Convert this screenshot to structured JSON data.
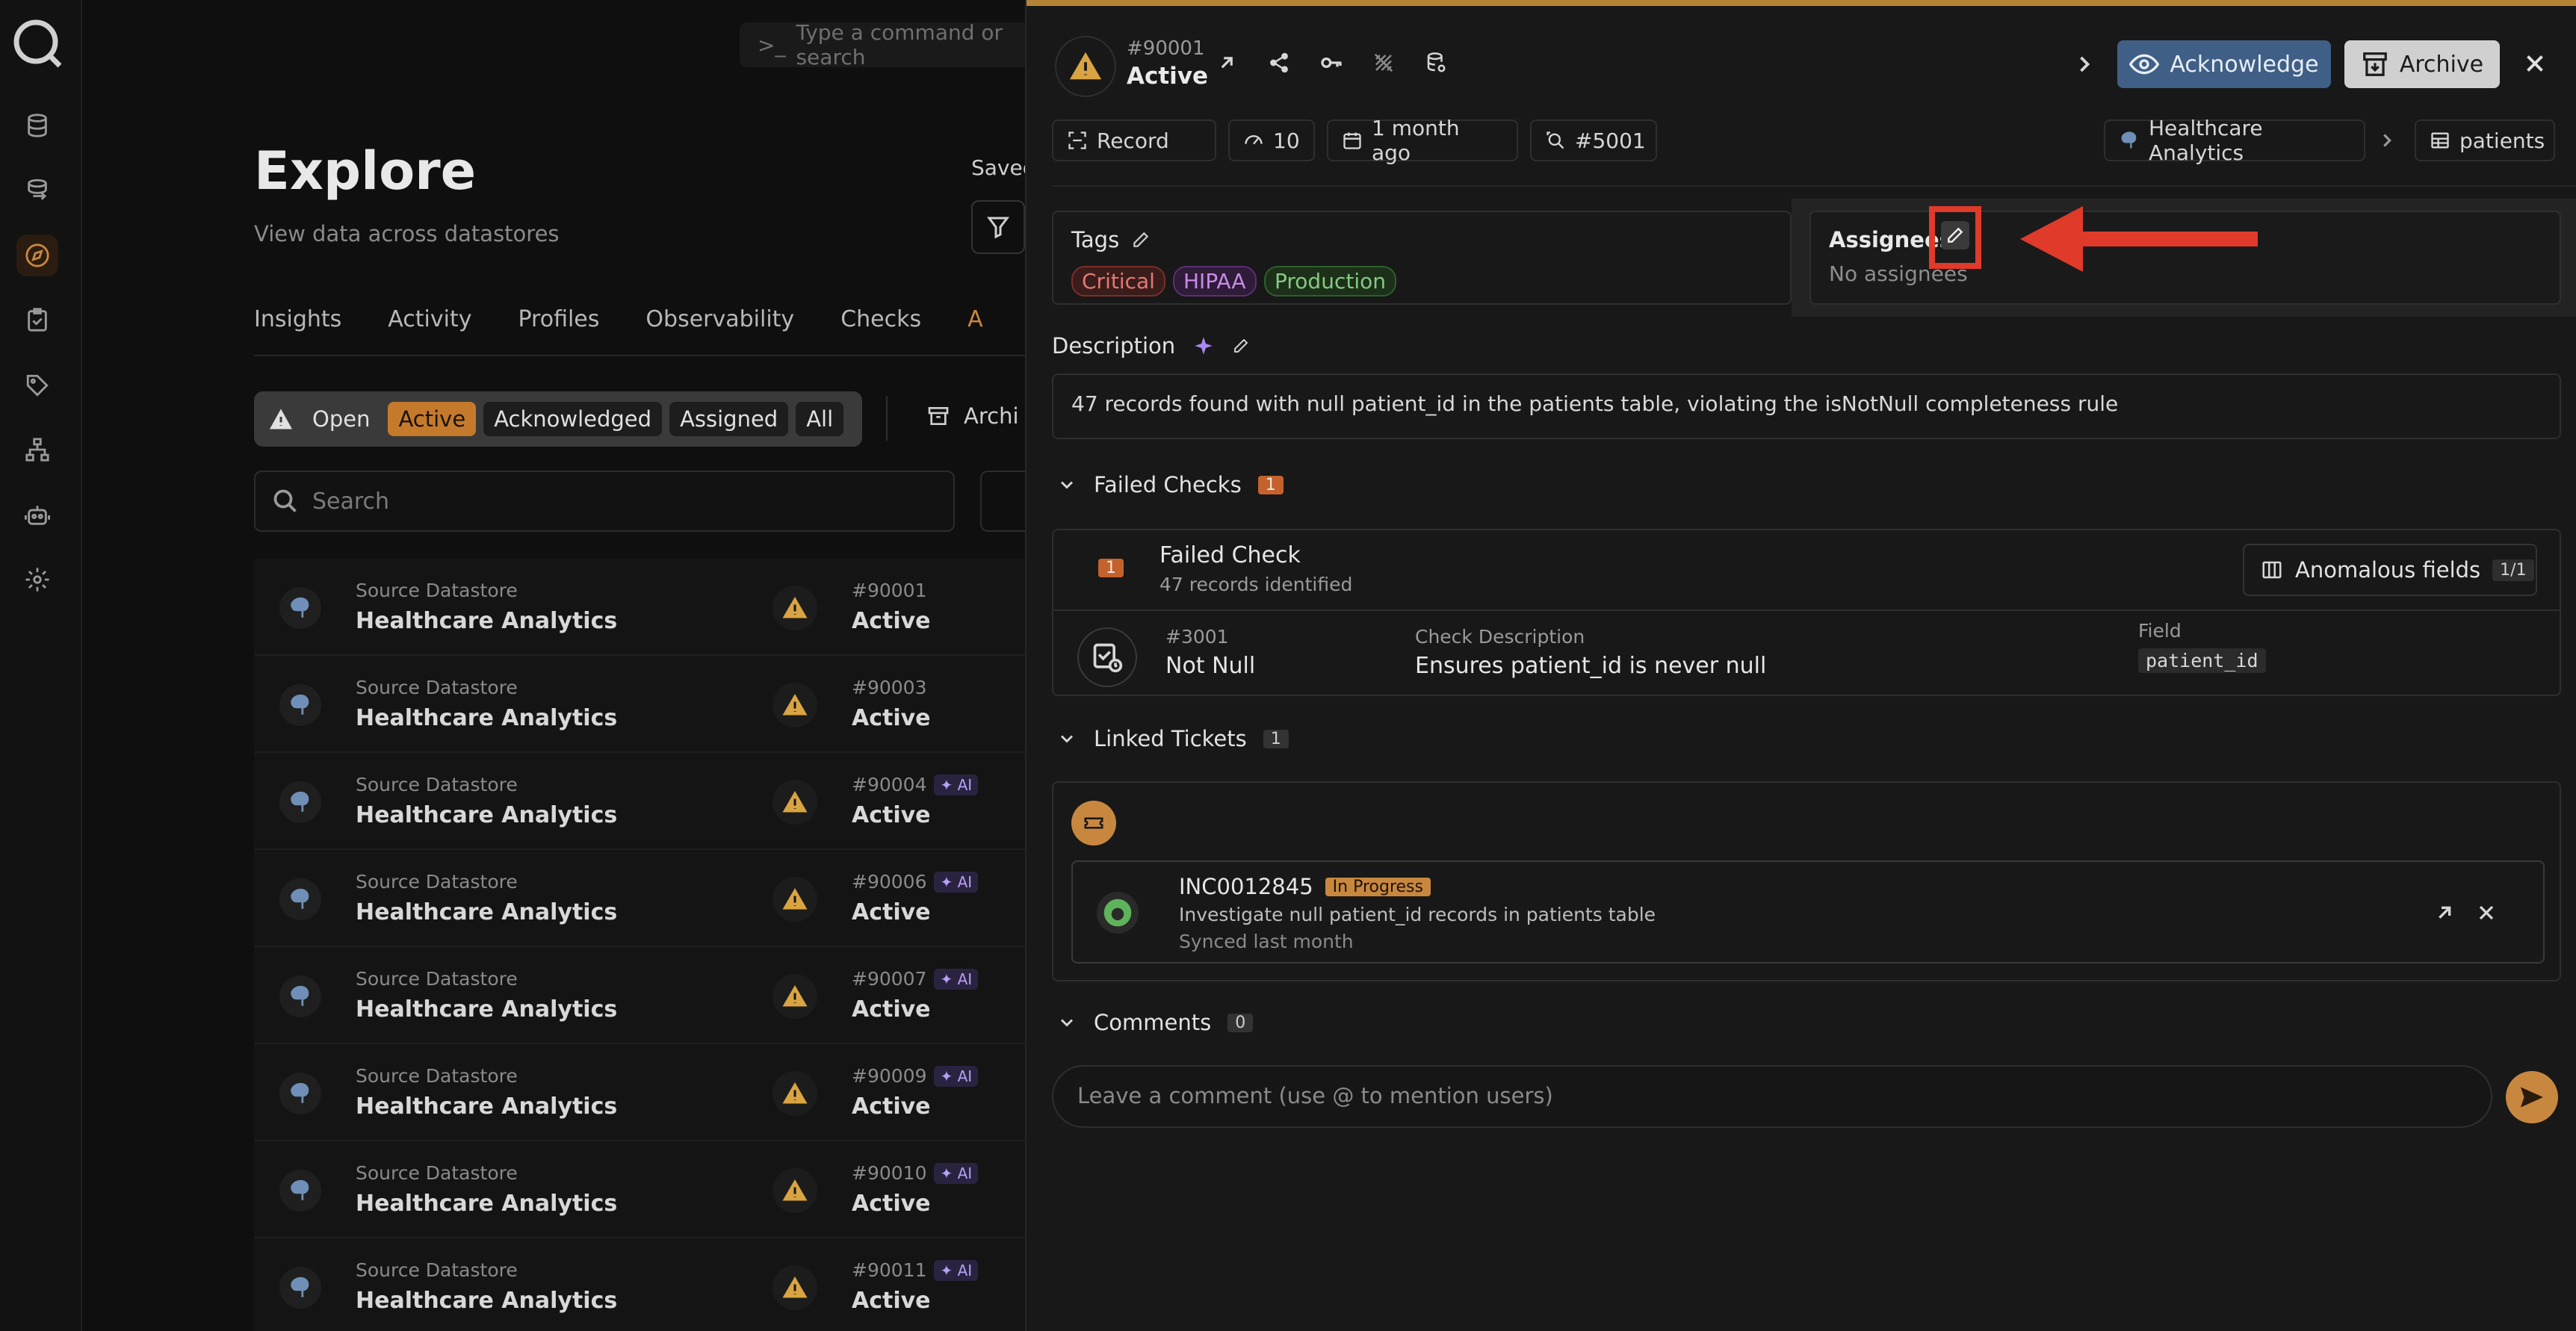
{
  "command_bar": {
    "placeholder": "Type a command or search"
  },
  "page": {
    "title": "Explore",
    "subtitle": "View data across datastores",
    "saved_label": "Saved",
    "tabs": [
      "Insights",
      "Activity",
      "Profiles",
      "Observability",
      "Checks",
      "A"
    ],
    "status_filters": [
      "Open",
      "Active",
      "Acknowledged",
      "Assigned",
      "All"
    ],
    "archive_label": "Archi",
    "search_placeholder": "Search"
  },
  "list_rows": [
    {
      "source_label": "Source Datastore",
      "source_name": "Healthcare Analytics",
      "id": "#90001",
      "status": "Active",
      "ai": ""
    },
    {
      "source_label": "Source Datastore",
      "source_name": "Healthcare Analytics",
      "id": "#90003",
      "status": "Active",
      "ai": ""
    },
    {
      "source_label": "Source Datastore",
      "source_name": "Healthcare Analytics",
      "id": "#90004",
      "status": "Active",
      "ai": "AI"
    },
    {
      "source_label": "Source Datastore",
      "source_name": "Healthcare Analytics",
      "id": "#90006",
      "status": "Active",
      "ai": "AI"
    },
    {
      "source_label": "Source Datastore",
      "source_name": "Healthcare Analytics",
      "id": "#90007",
      "status": "Active",
      "ai": "AI"
    },
    {
      "source_label": "Source Datastore",
      "source_name": "Healthcare Analytics",
      "id": "#90009",
      "status": "Active",
      "ai": "AI"
    },
    {
      "source_label": "Source Datastore",
      "source_name": "Healthcare Analytics",
      "id": "#90010",
      "status": "Active",
      "ai": "AI"
    },
    {
      "source_label": "Source Datastore",
      "source_name": "Healthcare Analytics",
      "id": "#90011",
      "status": "Active",
      "ai": "AI"
    }
  ],
  "drawer": {
    "id": "#90001",
    "status": "Active",
    "acknowledge_label": "Acknowledge",
    "archive_label": "Archive",
    "meta": {
      "type": "Record",
      "score": "10",
      "age": "1 month ago",
      "scan": "#5001",
      "datastore": "Healthcare Analytics",
      "table": "patients"
    },
    "tags_label": "Tags",
    "tags": [
      {
        "name": "Critical",
        "color": "#d9534f"
      },
      {
        "name": "HIPAA",
        "color": "#b05fd6"
      },
      {
        "name": "Production",
        "color": "#5fb35a"
      }
    ],
    "assignees_label": "Assignees",
    "assignees_value": "No assignees",
    "description_label": "Description",
    "description": "47 records found with null patient_id in the patients table, violating the isNotNull completeness rule",
    "failed_checks": {
      "label": "Failed Checks",
      "count": "1",
      "item_num": "1",
      "item_title": "Failed Check",
      "item_sub": "47 records identified",
      "anomalous_label": "Anomalous fields",
      "anomalous_count": "1/1",
      "check_id": "#3001",
      "check_name": "Not Null",
      "desc_label": "Check Description",
      "desc_value": "Ensures patient_id is never null",
      "field_label": "Field",
      "field_value": "patient_id"
    },
    "linked_tickets": {
      "label": "Linked Tickets",
      "count": "1",
      "ticket_id": "INC0012845",
      "ticket_state": "In Progress",
      "ticket_desc": "Investigate null patient_id records in patients table",
      "ticket_sync": "Synced last month"
    },
    "comments": {
      "label": "Comments",
      "count": "0",
      "placeholder": "Leave a comment (use @ to mention users)"
    }
  },
  "colors": {
    "accent": "#c8873f",
    "acknowledge": "#3f5f86",
    "highlight": "#e03a2a"
  }
}
